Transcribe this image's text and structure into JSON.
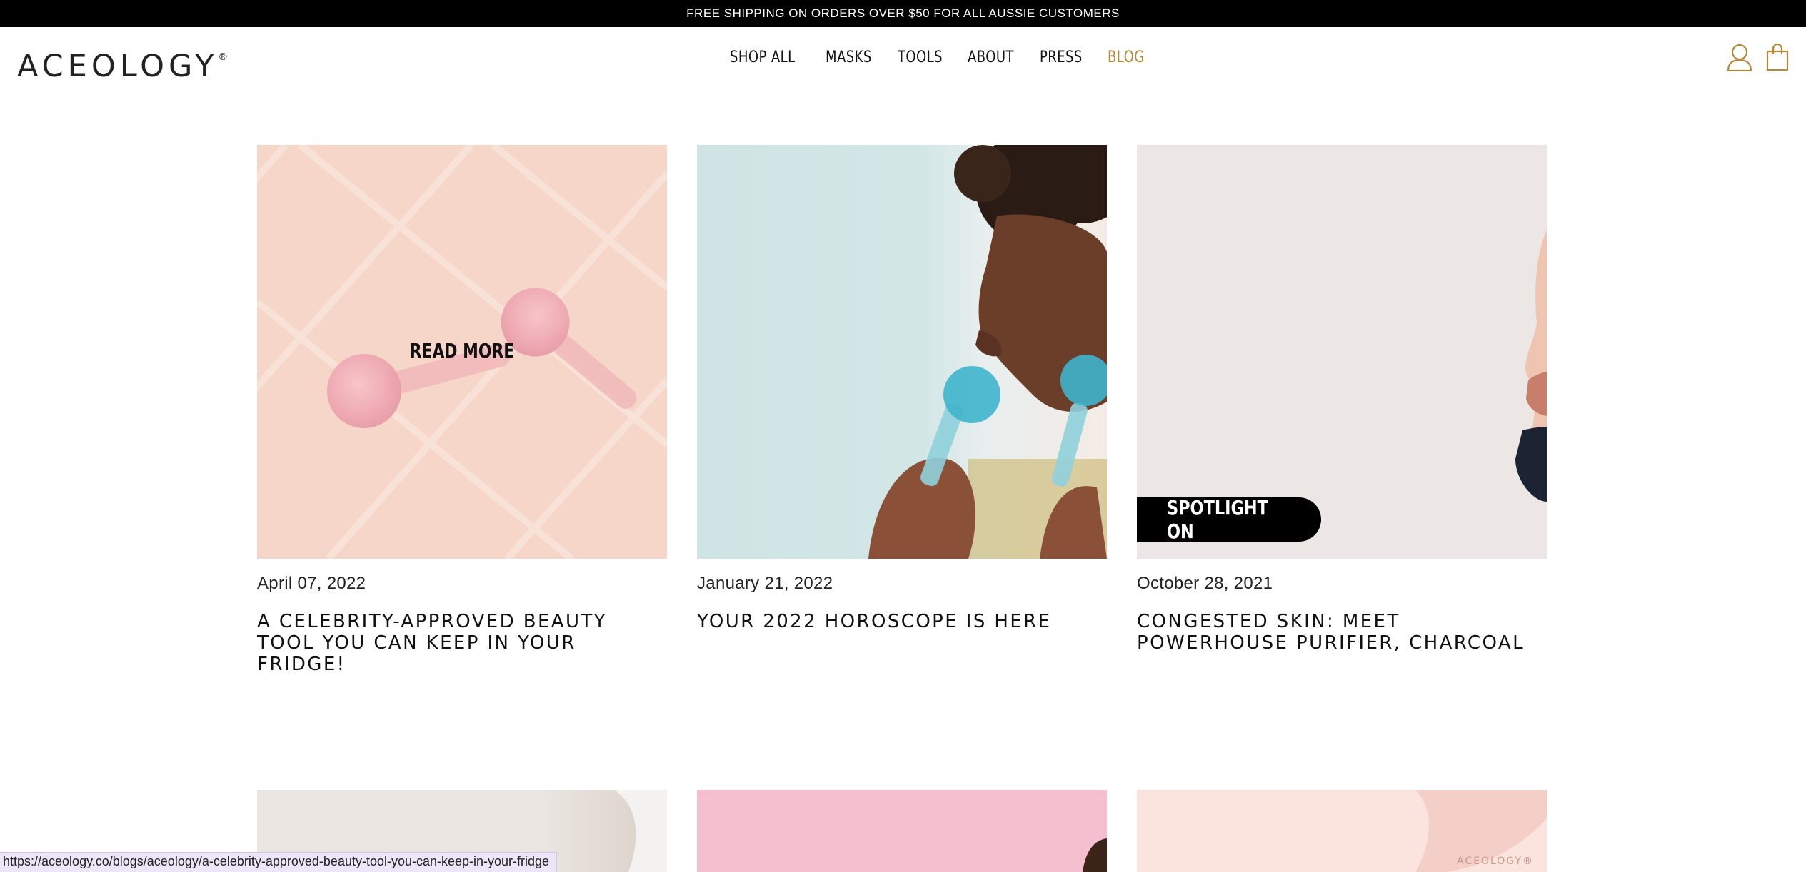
{
  "announcement": "FREE SHIPPING ON ORDERS OVER $50 FOR ALL AUSSIE CUSTOMERS",
  "brand": {
    "name": "ACEOLOGY",
    "reg": "®"
  },
  "nav": [
    {
      "label": "SHOP ALL"
    },
    {
      "label": "MASKS"
    },
    {
      "label": "TOOLS"
    },
    {
      "label": "ABOUT"
    },
    {
      "label": "PRESS"
    },
    {
      "label": "BLOG",
      "active": true
    }
  ],
  "icons": {
    "account": "user-icon",
    "cart": "shopping-bag-icon"
  },
  "colors": {
    "accent": "#b08a3a",
    "topbar": "#000000"
  },
  "posts": [
    {
      "date": "April 07, 2022",
      "title": "A CELEBRITY-APPROVED BEAUTY TOOL YOU CAN KEEP IN YOUR FRIDGE!",
      "overlay": "READ MORE"
    },
    {
      "date": "January 21, 2022",
      "title": "YOUR 2022 HOROSCOPE IS HERE"
    },
    {
      "date": "October 28, 2021",
      "title": "CONGESTED SKIN: MEET POWERHOUSE PURIFIER, CHARCOAL",
      "badge": "SPOTLIGHT ON"
    }
  ],
  "thumb_text": {
    "product_brand": "ACEOLOGY®"
  },
  "status_url": "https://aceology.co/blogs/aceology/a-celebrity-approved-beauty-tool-you-can-keep-in-your-fridge"
}
